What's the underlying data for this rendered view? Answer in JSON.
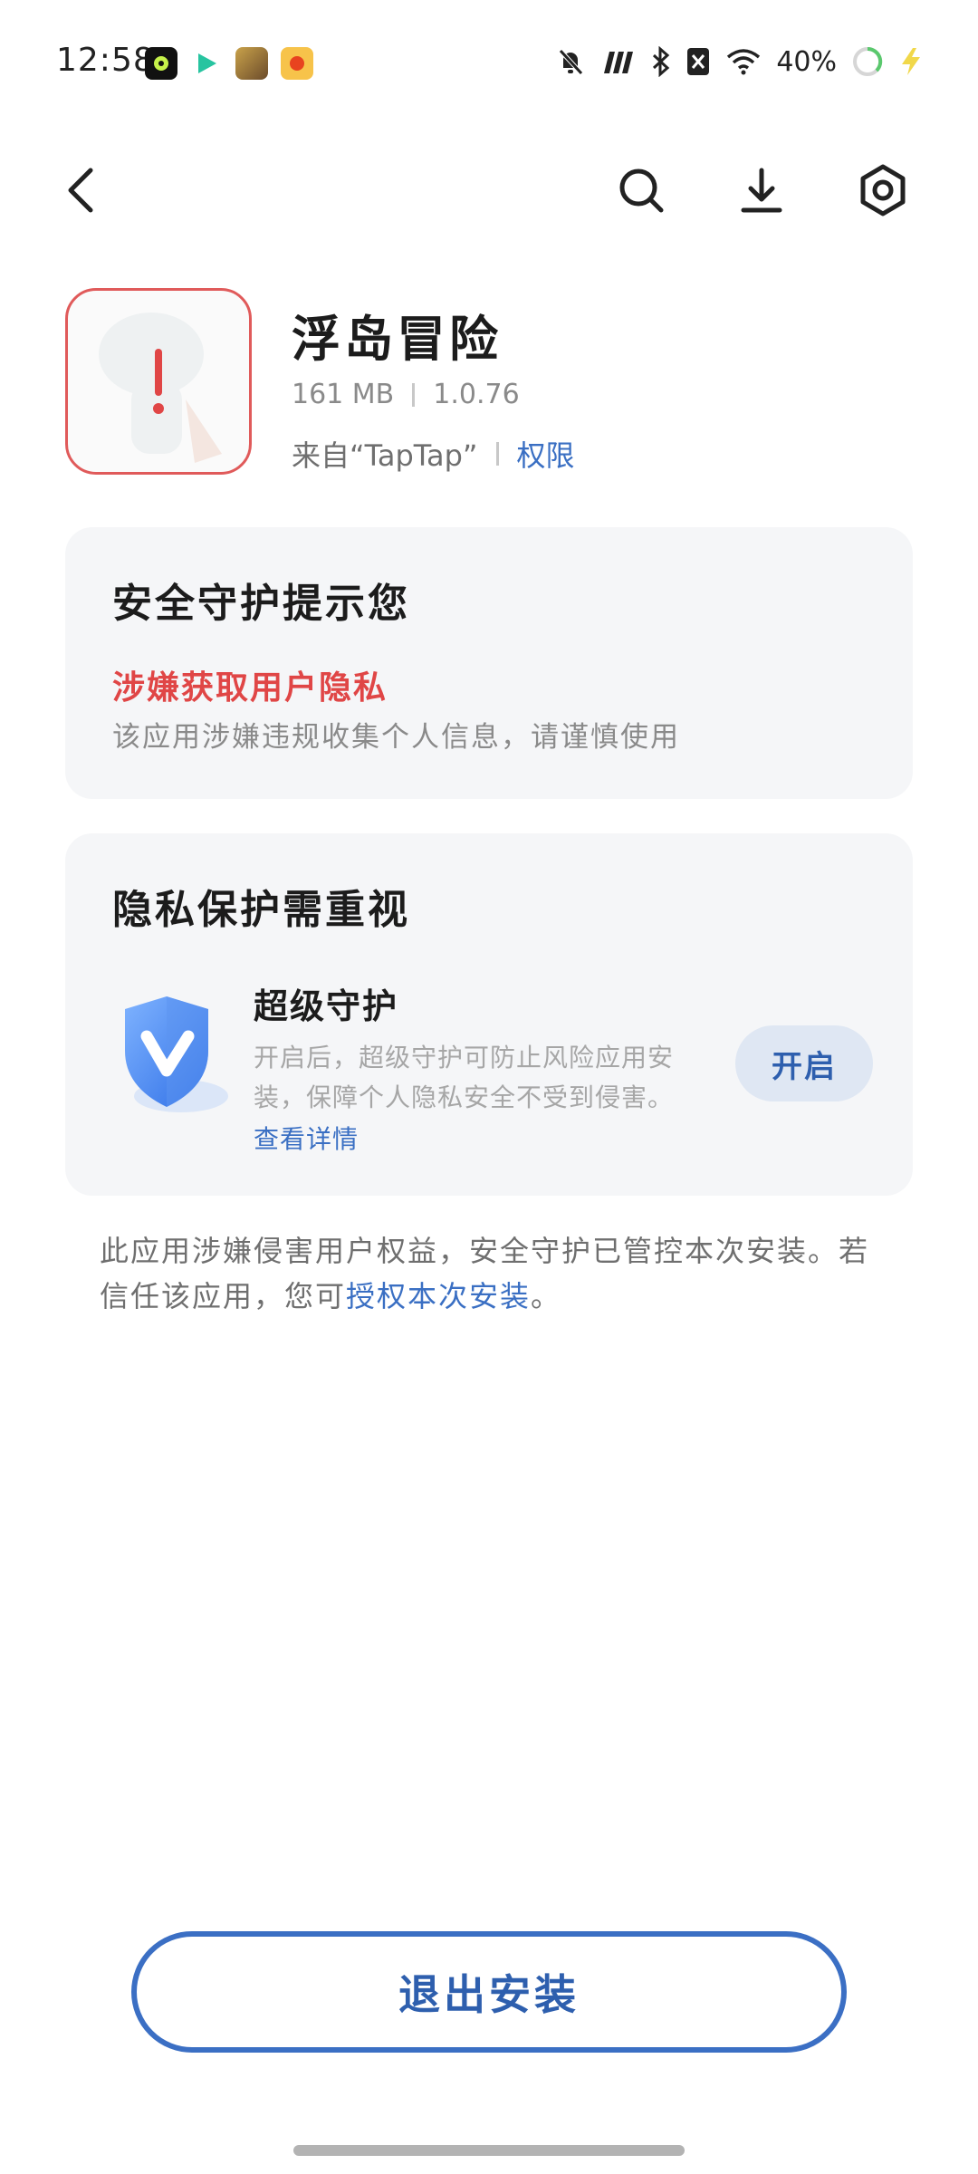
{
  "status_bar": {
    "time": "12:58",
    "battery_percent": "40%",
    "notification_icons": [
      "music-app-icon",
      "video-play-icon",
      "game-app-icon",
      "shopping-app-icon"
    ],
    "system_icons": [
      "mute-bell-icon",
      "signal-icon",
      "bluetooth-icon",
      "no-sim-icon",
      "wifi-icon",
      "battery-ring-icon",
      "charging-bolt-icon"
    ]
  },
  "toolbar": {
    "icons": [
      "back-arrow-icon",
      "search-icon",
      "download-icon",
      "settings-hexagon-icon"
    ]
  },
  "app": {
    "name": "浮岛冒险",
    "size": "161 MB",
    "version": "1.0.76",
    "source": "来自“TapTap”",
    "permissions_label": "权限",
    "icon": "app-warning-icon"
  },
  "safety_card": {
    "title": "安全守护提示您",
    "risk_title": "涉嫌获取用户隐私",
    "risk_desc": "该应用涉嫌违规收集个人信息，请谨慎使用"
  },
  "privacy_card": {
    "title": "隐私保护需重视",
    "feature_title": "超级守护",
    "feature_desc": "开启后，超级守护可防止风险应用安装，保障个人隐私安全不受到侵害。",
    "details_link": "查看详情",
    "enable_label": "开启",
    "icon": "shield-v-icon"
  },
  "notice": {
    "text_before": "此应用涉嫌侵害用户权益，安全守护已管控本次安装。若信任该应用，您可",
    "link": "授权本次安装",
    "text_after": "。"
  },
  "footer": {
    "exit_label": "退出安装"
  },
  "colors": {
    "accent_blue": "#3b6fc4",
    "danger_red": "#e04646",
    "card_bg": "#f5f6f8"
  }
}
